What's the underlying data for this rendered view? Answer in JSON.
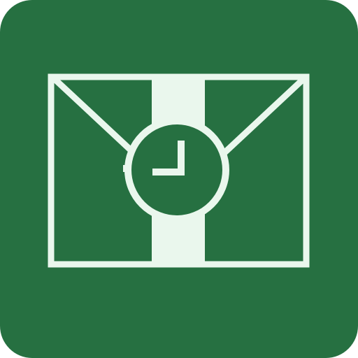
{
  "icon": {
    "name": "mail-clock-icon",
    "colors": {
      "background": "#267041",
      "foreground": "#EAF7ED"
    }
  }
}
